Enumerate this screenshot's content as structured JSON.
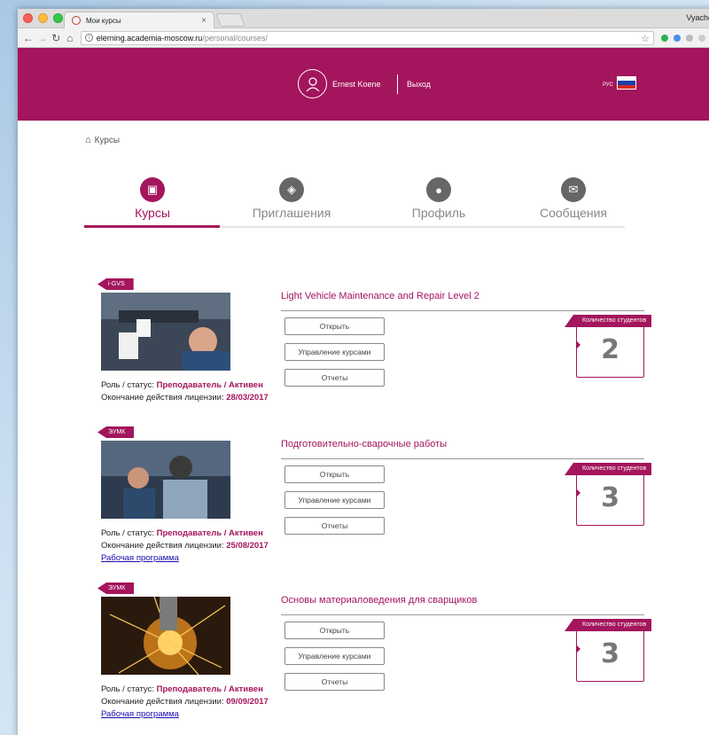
{
  "browser": {
    "tab_title": "Мои курсы",
    "user_label": "Vyache",
    "url_host": "elerning.academia-moscow.ru",
    "url_path": "/personal/courses/"
  },
  "header": {
    "user_name": "Ernest Koene",
    "logout": "Выход",
    "lang": "РУС"
  },
  "breadcrumb": {
    "label": "Курсы"
  },
  "nav_tabs": [
    {
      "label": "Курсы",
      "icon": "case-icon",
      "active": true
    },
    {
      "label": "Приглашения",
      "icon": "box-icon",
      "active": false
    },
    {
      "label": "Профиль",
      "icon": "profile-icon",
      "active": false
    },
    {
      "label": "Сообщения",
      "icon": "envelope-icon",
      "active": false
    }
  ],
  "labels": {
    "role_status": "Роль / статус:",
    "license_end": "Окончание действия лицензии:",
    "students_count": "Количество студентов",
    "open": "Открыть",
    "manage": "Управление курсами",
    "reports": "Отчеты",
    "program": "Рабочая программа"
  },
  "courses": [
    {
      "tag": "i-GVS",
      "title": "Light Vehicle Maintenance and Repair Level 2",
      "role": "Преподаватель / Активен",
      "license": "28/03/2017",
      "students": "2",
      "program": ""
    },
    {
      "tag": "ЭУМК",
      "title": "Подготовительно-сварочные работы",
      "role": "Преподаватель / Активен",
      "license": "25/08/2017",
      "students": "3",
      "program": "Рабочая программа"
    },
    {
      "tag": "ЭУМК",
      "title": "Основы материаловедения для сварщиков",
      "role": "Преподаватель / Активен",
      "license": "09/09/2017",
      "students": "3",
      "program": "Рабочая программа"
    }
  ],
  "colors": {
    "brand": "#a3155c",
    "link": "#1a0dab"
  }
}
